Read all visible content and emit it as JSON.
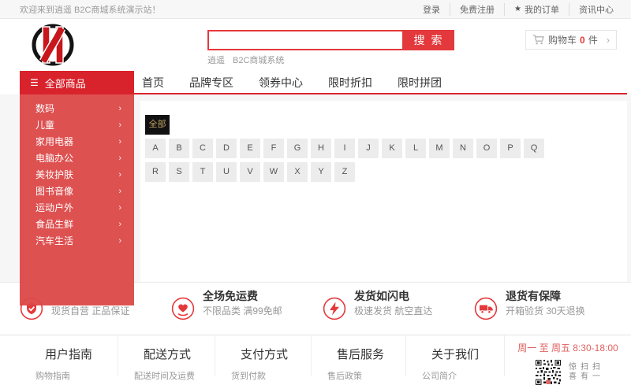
{
  "colors": {
    "accent": "#e4393c",
    "nav-red": "#d9232c",
    "sidebar-red": "rgba(220,72,72,0.95)",
    "sel-bg": "#111111",
    "sel-tx": "#c2a366",
    "hours": "#e06161"
  },
  "topbar": {
    "welcome": "欢迎来到逍遥 B2C商城系统演示站！",
    "login": "登录",
    "register": "免费注册",
    "orders": "我的订单",
    "news": "资讯中心"
  },
  "header": {
    "search_button": "搜索",
    "hot_words": [
      "逍遥",
      "B2C商城系统"
    ],
    "cart_label": "购物车",
    "cart_count": "0",
    "cart_unit": "件"
  },
  "nav": {
    "all_label": "全部商品",
    "links": [
      "首页",
      "品牌专区",
      "领券中心",
      "限时折扣",
      "限时拼团"
    ]
  },
  "sidebar": {
    "items": [
      "数码",
      "儿童",
      "家用电器",
      "电脑办公",
      "美妆护肤",
      "图书音像",
      "运动户外",
      "食品生鲜",
      "汽车生活"
    ]
  },
  "letters": {
    "selected": "全部",
    "row1": [
      "A",
      "B",
      "C",
      "D",
      "E",
      "F",
      "G",
      "H",
      "I",
      "J",
      "K",
      "L",
      "M",
      "N",
      "O",
      "P",
      "Q"
    ],
    "row2": [
      "R",
      "S",
      "T",
      "U",
      "V",
      "W",
      "X",
      "Y",
      "Z"
    ]
  },
  "features": [
    {
      "title": "",
      "sub": "现货自营 正品保证"
    },
    {
      "title": "全场免运费",
      "sub": "不限品类 满99免邮"
    },
    {
      "title": "发货如闪电",
      "sub": "极速发货 航空直达"
    },
    {
      "title": "退货有保障",
      "sub": "开箱验货 30天退换"
    }
  ],
  "footer": {
    "columns": [
      {
        "title": "用户指南",
        "link": "购物指南"
      },
      {
        "title": "配送方式",
        "link": "配送时间及运费"
      },
      {
        "title": "支付方式",
        "link": "货到付款"
      },
      {
        "title": "售后服务",
        "link": "售后政策"
      },
      {
        "title": "关于我们",
        "link": "公司简介"
      }
    ],
    "hours": "周一 至 周五  8:30-18:00",
    "qr_caption": "扫一扫有惊喜"
  }
}
